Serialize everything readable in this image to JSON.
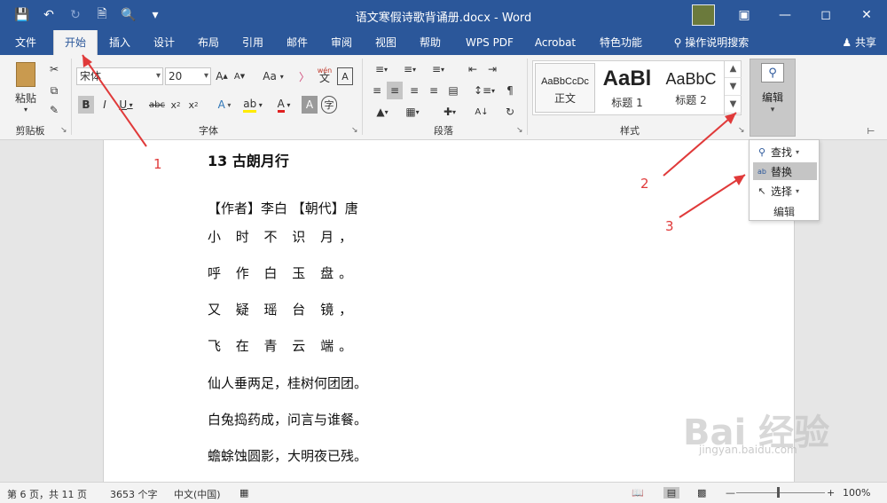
{
  "window": {
    "title": "语文寒假诗歌背诵册.docx - Word",
    "controls": [
      "restore-ribbon-icon",
      "minimize-icon",
      "maximize-icon",
      "close-icon"
    ]
  },
  "qat": {
    "icons": [
      "save-icon",
      "undo-icon",
      "redo-icon",
      "new-icon",
      "print-preview-icon",
      "customize-icon"
    ]
  },
  "tabs": [
    "文件",
    "开始",
    "插入",
    "设计",
    "布局",
    "引用",
    "邮件",
    "审阅",
    "视图",
    "帮助",
    "WPS PDF",
    "Acrobat",
    "特色功能",
    "操作说明搜索"
  ],
  "active_tab": "开始",
  "share_label": "共享",
  "ribbon": {
    "clipboard": {
      "paste_label": "粘贴",
      "group_label": "剪贴板"
    },
    "font": {
      "font_name": "宋体",
      "font_size": "20",
      "group_label": "字体",
      "wen_label": "wén",
      "wen_char": "文",
      "aa_label": "Aa"
    },
    "paragraph": {
      "group_label": "段落"
    },
    "styles": {
      "group_label": "样式",
      "items": [
        {
          "preview": "AaBbCcDc",
          "name": "正文"
        },
        {
          "preview": "AaBl",
          "name": "标题 1"
        },
        {
          "preview": "AaBbC",
          "name": "标题 2"
        }
      ]
    },
    "editing": {
      "label": "编辑"
    }
  },
  "edit_menu": {
    "items": [
      {
        "label": "查找",
        "icon": "search-icon"
      },
      {
        "label": "替换",
        "icon": "replace-icon"
      },
      {
        "label": "选择",
        "icon": "cursor-icon"
      }
    ],
    "footer": "编辑"
  },
  "document": {
    "lines": [
      "13  古朗月行",
      "【作者】李白 【朝代】唐",
      "小 时 不 识 月，",
      "呼 作 白 玉 盘。",
      "又 疑 瑶 台 镜，",
      "飞 在 青 云 端。",
      "仙人垂两足，桂树何团团。",
      "白兔捣药成，问言与谁餐。",
      "蟾蜍蚀圆影，大明夜已残。"
    ]
  },
  "annotations": [
    "1",
    "2",
    "3"
  ],
  "statusbar": {
    "page": "第 6 页，共 11 页",
    "words": "3653 个字",
    "lang": "中文(中国)",
    "zoom": "100%"
  },
  "watermark": {
    "main": "Bai 经验",
    "url": "jingyan.baidu.com"
  }
}
